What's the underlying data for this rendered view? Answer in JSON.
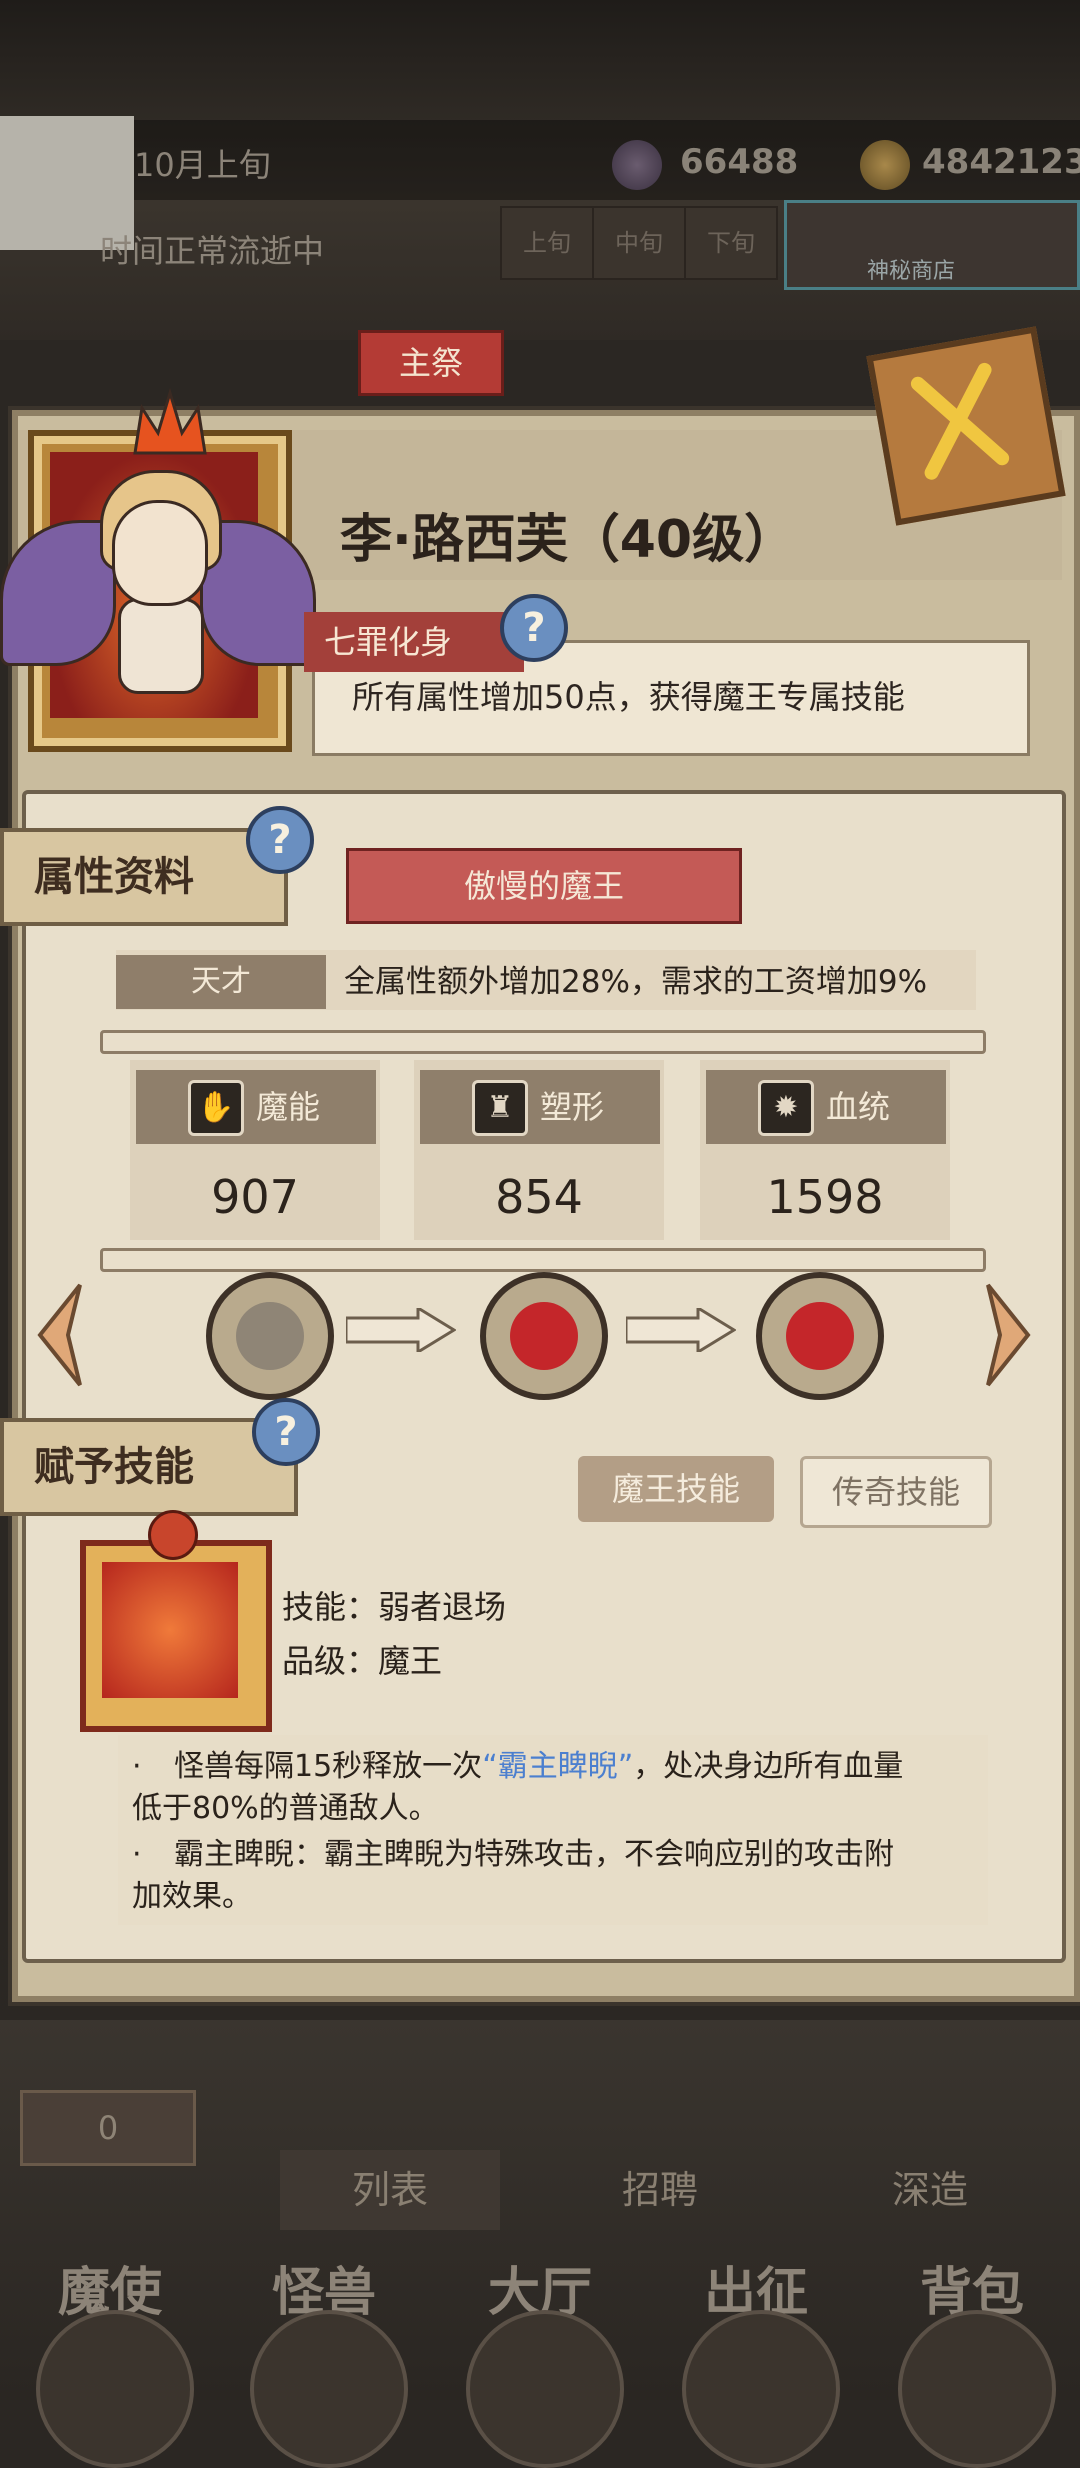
{
  "hud": {
    "date": "10月上旬",
    "time_status": "时间正常流逝中",
    "crystals": "66488",
    "gold": "4842123",
    "time_tabs": [
      "上旬",
      "中旬",
      "下旬"
    ],
    "shop_label": "神秘商店"
  },
  "tag_lord": "主祭",
  "character": {
    "name": "李·路西芙（40级）",
    "title": "七罪化身",
    "title_desc": "所有属性增加50点，获得魔王专属技能",
    "help_symbol": "?"
  },
  "attributes": {
    "section_title": "属性资料",
    "temperament": "傲慢的魔王",
    "talent_label": "天才",
    "talent_desc": "全属性额外增加28%，需求的工资增加9%",
    "stats": [
      {
        "label": "魔能",
        "value": "907",
        "icon": "claw-icon"
      },
      {
        "label": "塑形",
        "value": "854",
        "icon": "armor-icon"
      },
      {
        "label": "血统",
        "value": "1598",
        "icon": "gear-icon"
      }
    ]
  },
  "evolution": {
    "stages": [
      "hooded-figure-icon",
      "demon-face-icon",
      "demon-face-icon"
    ]
  },
  "skills": {
    "section_title": "赋予技能",
    "tab_active": "魔王技能",
    "tab_inactive": "传奇技能",
    "skill_name_line": "技能：弱者退场",
    "skill_grade_line": "品级：魔王",
    "desc_bullet": "·",
    "desc1_pre": "怪兽每隔15秒释放一次",
    "desc1_hl": "“霸主睥睨”",
    "desc1_post": "，处决身边所有血量",
    "desc1_line2": "低于80%的普通敌人。",
    "desc2_line1": "霸主睥睨：霸主睥睨为特殊攻击，不会响应别的攻击附",
    "desc2_line2": "加效果。"
  },
  "bottom": {
    "badge_count": "0",
    "tabs": [
      "列表",
      "招聘",
      "深造"
    ],
    "nav": [
      "魔使",
      "怪兽",
      "大厅",
      "出征",
      "背包"
    ]
  },
  "colors": {
    "accent_red": "#b43b35",
    "highlight_blue": "#4b7fcf",
    "parchment": "#e8dfcb"
  }
}
